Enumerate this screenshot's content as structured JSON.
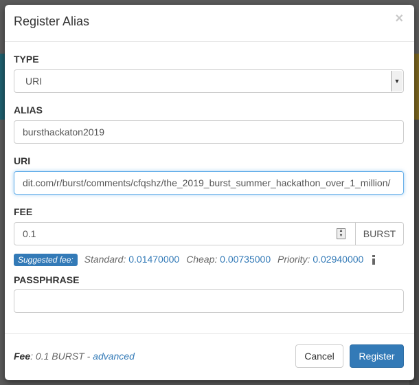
{
  "modal": {
    "title": "Register Alias",
    "close_symbol": "×"
  },
  "form": {
    "type": {
      "label": "TYPE",
      "selected": "URI"
    },
    "alias": {
      "label": "ALIAS",
      "value": "bursthackaton2019"
    },
    "uri": {
      "label": "URI",
      "value": "dit.com/r/burst/comments/cfqshz/the_2019_burst_summer_hackathon_over_1_million/"
    },
    "fee": {
      "label": "FEE",
      "value": "0.1",
      "unit": "BURST",
      "suggested_badge": "Suggested fee:",
      "options": [
        {
          "name": "Standard:",
          "value": "0.01470000"
        },
        {
          "name": "Cheap:",
          "value": "0.00735000"
        },
        {
          "name": "Priority:",
          "value": "0.02940000"
        }
      ]
    },
    "passphrase": {
      "label": "PASSPHRASE",
      "value": ""
    }
  },
  "footer": {
    "fee_label": "Fee",
    "fee_text": ": 0.1 BURST - ",
    "advanced_link": "advanced",
    "cancel_label": "Cancel",
    "register_label": "Register"
  },
  "colors": {
    "primary": "#337ab7",
    "focus": "#66afe9"
  },
  "icons": [
    "close-icon",
    "info-icon",
    "select-arrow-icon",
    "number-spinner-icon"
  ]
}
